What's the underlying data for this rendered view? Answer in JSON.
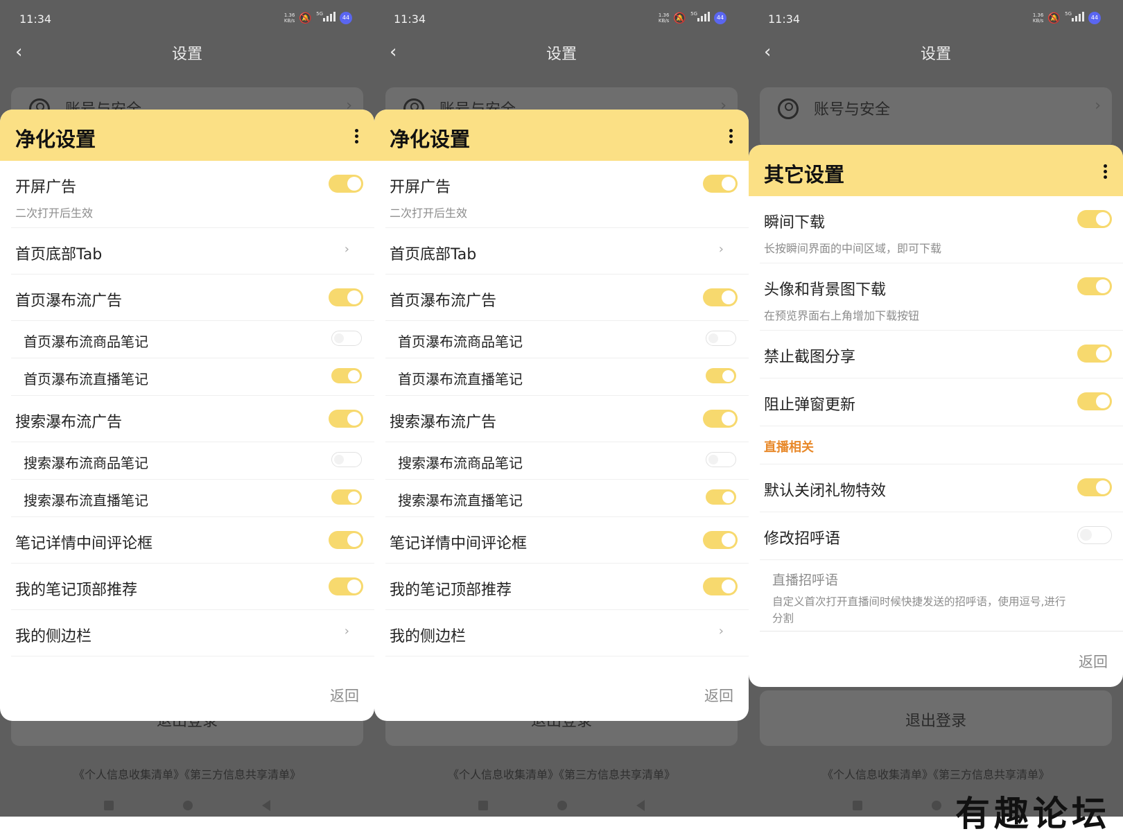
{
  "status_bar": {
    "time": "11:34",
    "speed": "1.36",
    "speed_unit": "KB/s",
    "network": "5G",
    "battery": "44"
  },
  "page": {
    "title": "设置",
    "account_label": "账号与安全",
    "logout_label": "退出登录",
    "policy_links": "《个人信息收集清单》《第三方信息共享清单》"
  },
  "panels": [
    {
      "title": "净化设置",
      "back_label": "返回",
      "items": [
        {
          "label": "开屏广告",
          "desc": "二次打开后生效",
          "control": "toggle",
          "on": true
        },
        {
          "label": "首页底部Tab",
          "control": "chevron"
        },
        {
          "label": "首页瀑布流广告",
          "control": "toggle",
          "on": true
        },
        {
          "label": "首页瀑布流商品笔记",
          "control": "toggle",
          "on": false,
          "sub": true
        },
        {
          "label": "首页瀑布流直播笔记",
          "control": "toggle",
          "on": true,
          "sub": true
        },
        {
          "label": "搜索瀑布流广告",
          "control": "toggle",
          "on": true
        },
        {
          "label": "搜索瀑布流商品笔记",
          "control": "toggle",
          "on": false,
          "sub": true
        },
        {
          "label": "搜索瀑布流直播笔记",
          "control": "toggle",
          "on": true,
          "sub": true
        },
        {
          "label": "笔记详情中间评论框",
          "control": "toggle",
          "on": true
        },
        {
          "label": "我的笔记顶部推荐",
          "control": "toggle",
          "on": true
        },
        {
          "label": "我的侧边栏",
          "control": "chevron"
        }
      ]
    },
    {
      "title": "其它设置",
      "back_label": "返回",
      "section_label": "直播相关",
      "items": [
        {
          "label": "瞬间下载",
          "desc": "长按瞬间界面的中间区域，即可下载",
          "control": "toggle",
          "on": true
        },
        {
          "label": "头像和背景图下载",
          "desc": "在预览界面右上角增加下载按钮",
          "control": "toggle",
          "on": true
        },
        {
          "label": "禁止截图分享",
          "control": "toggle",
          "on": true
        },
        {
          "label": "阻止弹窗更新",
          "control": "toggle",
          "on": true
        },
        {
          "label": "默认关闭礼物特效",
          "control": "toggle",
          "on": true
        },
        {
          "label": "修改招呼语",
          "control": "toggle",
          "on": false
        }
      ],
      "greeting": {
        "placeholder": "直播招呼语",
        "desc_line1": "自定义首次打开直播间时候快捷发送的招呼语，使用逗号,进行",
        "desc_line2": "分割"
      }
    }
  ],
  "watermark": "有趣论坛",
  "colors": {
    "accent_yellow": "#fbe085",
    "toggle_on": "#f7d96e",
    "section_orange": "#e8892a",
    "battery_badge": "#5a66f0"
  }
}
